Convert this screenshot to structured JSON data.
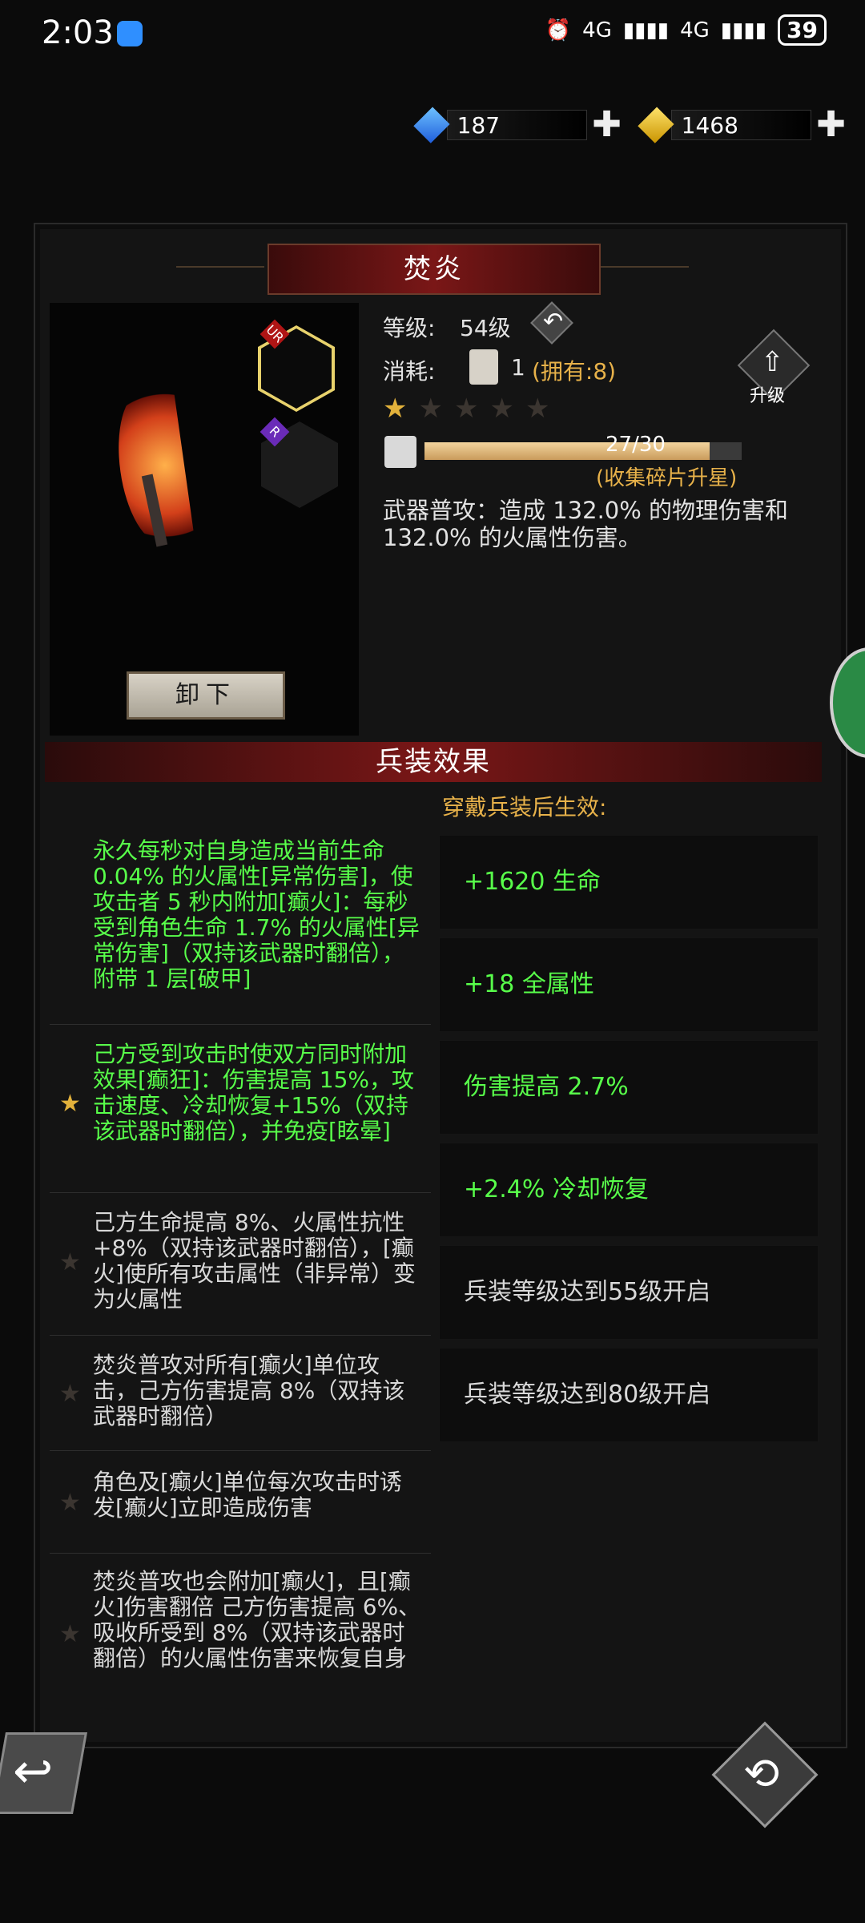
{
  "status_bar": {
    "time": "2:03",
    "signal1": "4G",
    "signal2": "4G",
    "battery": "39"
  },
  "currency": {
    "blue": {
      "amount": "187"
    },
    "gold": {
      "amount": "1468"
    }
  },
  "weapon": {
    "title": "焚炎",
    "level_label": "等级:",
    "level_value": "54级",
    "cost_label": "消耗:",
    "cost_amount": "1",
    "owned_text": "(拥有:8)",
    "upgrade_label": "升级",
    "stars_filled": 1,
    "stars_total": 5,
    "fragments_text": "27/30",
    "fragments_progress": 0.9,
    "fragments_hint": "(收集碎片升星)",
    "description": "武器普攻：造成 132.0% 的物理伤害和132.0% 的火属性伤害。",
    "equipped_badges": [
      "UR",
      "R"
    ],
    "unequip_label": "卸下"
  },
  "effects": {
    "header": "兵装效果",
    "wear_label": "穿戴兵装后生效:",
    "left_items": [
      {
        "color": "green",
        "star": false,
        "text": "永久每秒对自身造成当前生命0.04% 的火属性[异常伤害]，使攻击者 5 秒内附加[癫火]：每秒受到角色生命 1.7% 的火属性[异常伤害]（双持该武器时翻倍），附带 1 层[破甲]"
      },
      {
        "color": "green",
        "star": true,
        "text": "己方受到攻击时使双方同时附加效果[癫狂]：伤害提高 15%，攻击速度、冷却恢复+15%（双持该武器时翻倍），并免疫[眩晕]"
      },
      {
        "color": "gray",
        "star": true,
        "text": "己方生命提高 8%、火属性抗性+8%（双持该武器时翻倍），[癫火]使所有攻击属性（非异常）变为火属性"
      },
      {
        "color": "gray",
        "star": true,
        "text": "焚炎普攻对所有[癫火]单位攻击，己方伤害提高 8%（双持该武器时翻倍）"
      },
      {
        "color": "gray",
        "star": true,
        "text": "角色及[癫火]单位每次攻击时诱发[癫火]立即造成伤害"
      },
      {
        "color": "gray",
        "star": true,
        "text": "焚炎普攻也会附加[癫火]，且[癫火]伤害翻倍 己方伤害提高 6%、吸收所受到 8%（双持该武器时翻倍）的火属性伤害来恢复自身"
      }
    ],
    "right_items": [
      {
        "color": "green",
        "text": "+1620 生命"
      },
      {
        "color": "green",
        "text": "+18 全属性"
      },
      {
        "color": "green",
        "text": "伤害提高 2.7%"
      },
      {
        "color": "green",
        "text": "+2.4% 冷却恢复"
      },
      {
        "color": "gray",
        "text": "兵装等级达到55级开启"
      },
      {
        "color": "gray",
        "text": "兵装等级达到80级开启"
      }
    ]
  }
}
